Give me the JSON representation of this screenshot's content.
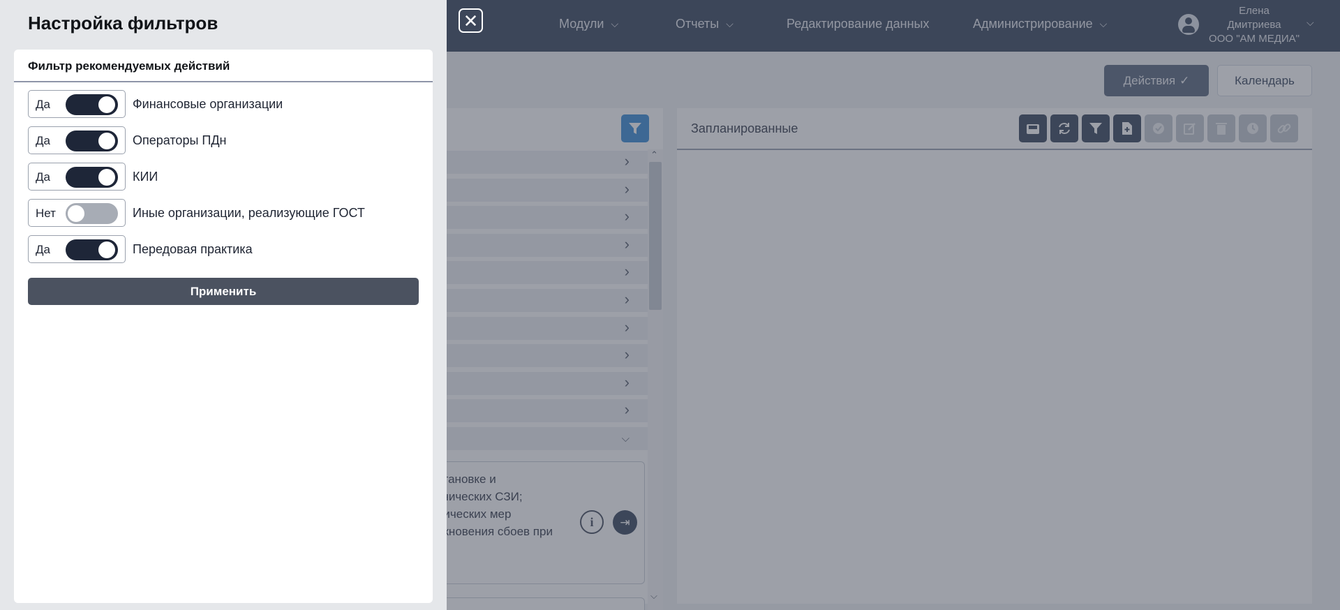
{
  "topbar": {
    "nav": [
      {
        "label": "Модули",
        "has_dropdown": true
      },
      {
        "label": "Отчеты",
        "has_dropdown": true
      },
      {
        "label": "Редактирование данных",
        "has_dropdown": false
      },
      {
        "label": "Администрирование",
        "has_dropdown": true
      }
    ],
    "user": {
      "first_name": "Елена",
      "last_name": "Дмитриева",
      "organization": "ООО \"АМ МЕДИА\""
    }
  },
  "toolbar": {
    "actions_label": "Действия",
    "actions_check": "✓",
    "calendar_label": "Календарь"
  },
  "left_panel": {
    "rows": 11,
    "card_text": "становке и\nкнических СЗИ;\nнических мер\nикновения сбоев при"
  },
  "right_panel": {
    "title": "Запланированные",
    "buttons": [
      {
        "icon": "inbox-icon",
        "enabled": true
      },
      {
        "icon": "refresh-icon",
        "enabled": true
      },
      {
        "icon": "filter-icon",
        "enabled": true
      },
      {
        "icon": "add-file-icon",
        "enabled": true
      },
      {
        "icon": "check-circle-icon",
        "enabled": false
      },
      {
        "icon": "edit-icon",
        "enabled": false
      },
      {
        "icon": "trash-icon",
        "enabled": false
      },
      {
        "icon": "clock-icon",
        "enabled": false
      },
      {
        "icon": "link-icon",
        "enabled": false
      }
    ]
  },
  "drawer": {
    "title": "Настройка фильтров",
    "section_title": "Фильтр рекомендуемых действий",
    "filters": [
      {
        "state_text": "Да",
        "on": true,
        "label": "Финансовые организации"
      },
      {
        "state_text": "Да",
        "on": true,
        "label": "Операторы ПДн"
      },
      {
        "state_text": "Да",
        "on": true,
        "label": "КИИ"
      },
      {
        "state_text": "Нет",
        "on": false,
        "label": "Иные организации, реализующие ГОСТ"
      },
      {
        "state_text": "Да",
        "on": true,
        "label": "Передовая практика"
      }
    ],
    "apply_label": "Применить"
  },
  "colors": {
    "topbar": "#3d4a60",
    "switch_on": "#1e2638",
    "switch_off": "#a7acb5",
    "apply_button": "#4b5260",
    "filter_accent": "#3f8fd6"
  }
}
